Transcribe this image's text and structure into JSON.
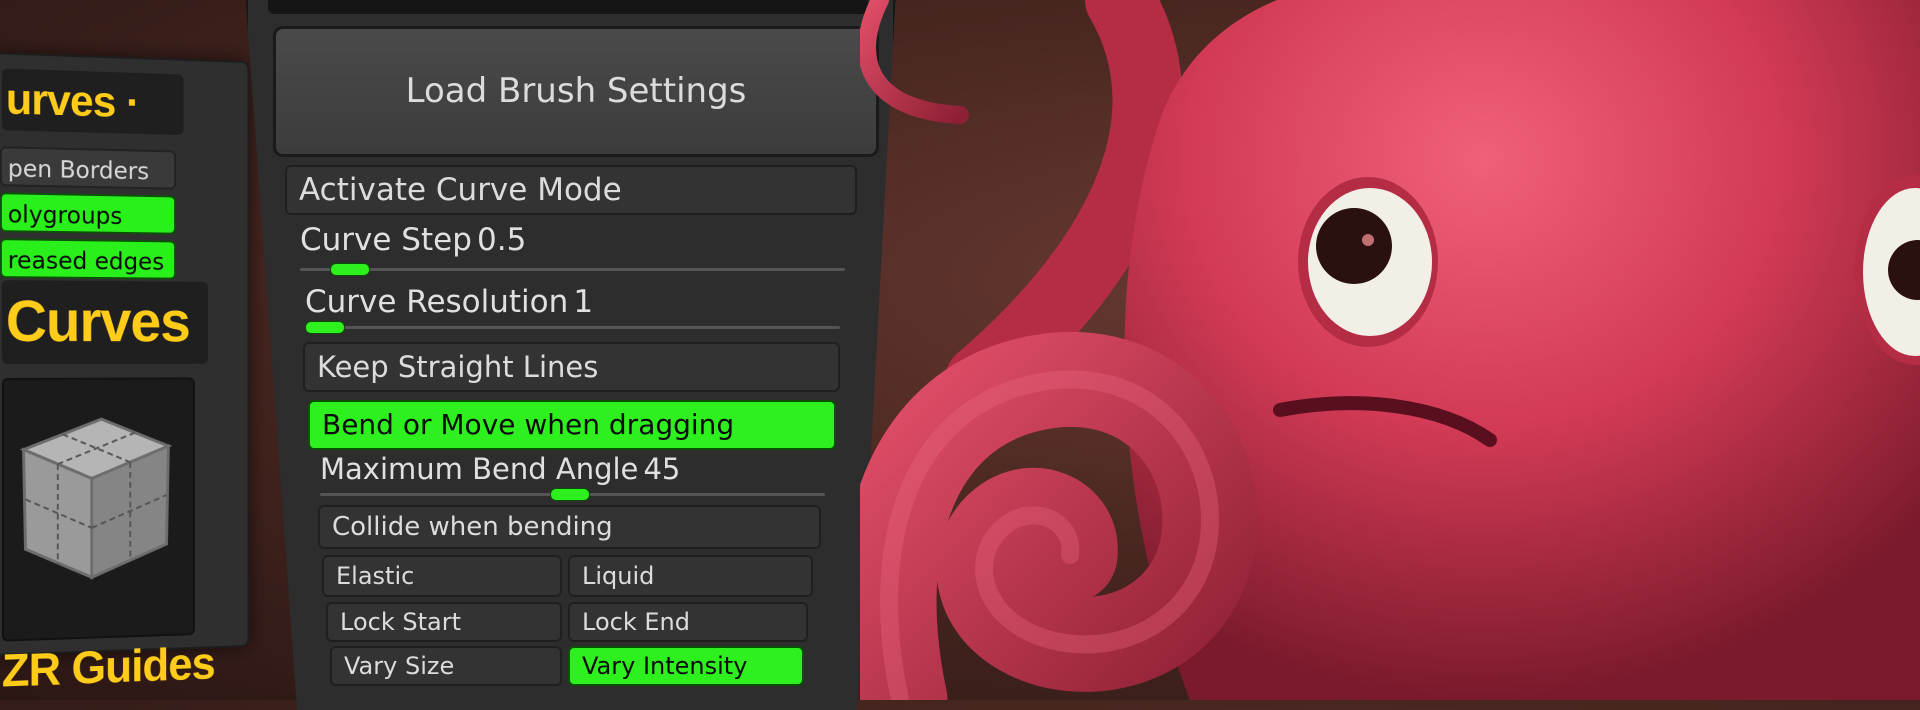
{
  "left_panel": {
    "title_top": "urves ·",
    "buttons": [
      {
        "label": "pen Borders",
        "active": false
      },
      {
        "label": "olygroups",
        "active": true
      },
      {
        "label": "reased edges",
        "active": true
      }
    ],
    "title_mid": "Curves ·",
    "thumbnail_icon": "cube-icon",
    "guides_label": "ZR Guides"
  },
  "brush_panel": {
    "load_label": "Load Brush Settings",
    "activate_curve_mode": "Activate Curve Mode",
    "curve_step": {
      "label": "Curve Step",
      "value": "0.5"
    },
    "curve_resolution": {
      "label": "Curve Resolution",
      "value": "1"
    },
    "keep_straight_lines": "Keep Straight Lines",
    "bend_or_move": "Bend or Move when dragging",
    "max_bend_angle": {
      "label": "Maximum Bend Angle",
      "value": "45"
    },
    "collide": "Collide when bending",
    "toggles": {
      "elastic": "Elastic",
      "liquid": "Liquid",
      "lock_start": "Lock Start",
      "lock_end": "Lock End",
      "vary_size": "Vary Size",
      "vary_intensity": "Vary Intensity"
    }
  },
  "colors": {
    "accent_green": "#2ef01f",
    "title_yellow": "#ffcc1a",
    "octopus_red": "#d23a55"
  }
}
